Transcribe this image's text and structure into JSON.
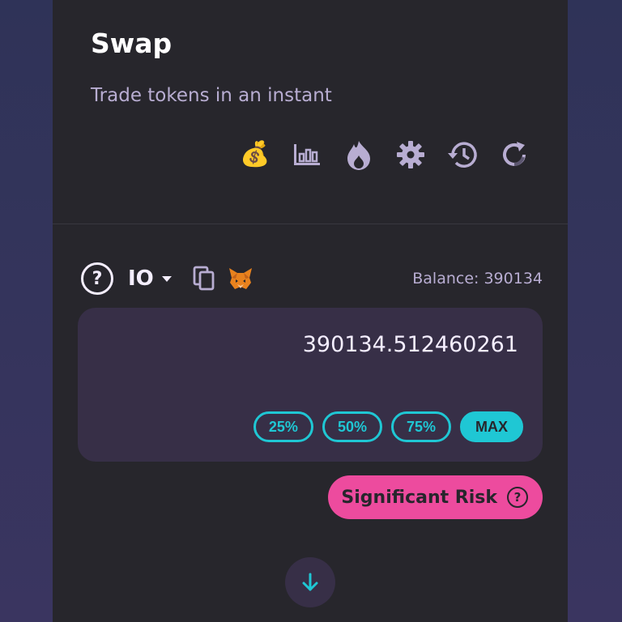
{
  "header": {
    "title": "Swap",
    "subtitle": "Trade tokens in an instant"
  },
  "toolbar": {
    "icons": [
      "money-bag-icon",
      "chart-icon",
      "fire-icon",
      "gear-icon",
      "history-icon",
      "refresh-icon"
    ]
  },
  "input": {
    "token_symbol": "IO",
    "balance": "Balance: 390134",
    "amount": "390134.512460261",
    "percent_buttons": [
      "25%",
      "50%",
      "75%",
      "MAX"
    ]
  },
  "risk": {
    "label": "Significant Risk",
    "icon_glyph": "?"
  },
  "colors": {
    "card": "#27262c",
    "accent": "#1fc7d4",
    "risk": "#ed4b9e",
    "input_bg": "#372f47",
    "text_secondary": "#b8add2"
  }
}
